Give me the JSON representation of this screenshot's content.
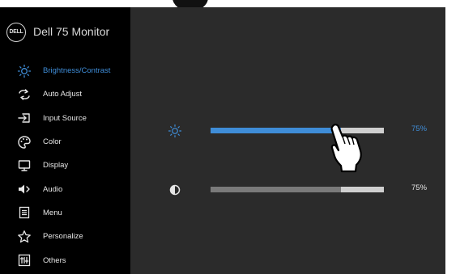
{
  "brand": {
    "title": "Dell 75 Monitor",
    "logo_text": "DELL"
  },
  "menu": [
    {
      "label": "Brightness/Contrast",
      "icon": "brightness-icon",
      "active": true
    },
    {
      "label": "Auto Adjust",
      "icon": "auto-adjust-icon",
      "active": false
    },
    {
      "label": "Input Source",
      "icon": "input-source-icon",
      "active": false
    },
    {
      "label": "Color",
      "icon": "color-palette-icon",
      "active": false
    },
    {
      "label": "Display",
      "icon": "display-icon",
      "active": false
    },
    {
      "label": "Audio",
      "icon": "speaker-icon",
      "active": false
    },
    {
      "label": "Menu",
      "icon": "menu-icon",
      "active": false
    },
    {
      "label": "Personalize",
      "icon": "star-icon",
      "active": false
    },
    {
      "label": "Others",
      "icon": "others-icon",
      "active": false
    }
  ],
  "brightness": {
    "icon": "brightness-icon",
    "value": 75,
    "value_label": "75%"
  },
  "contrast": {
    "icon": "contrast-icon",
    "value": 75,
    "value_label": "75%"
  },
  "colors": {
    "accent": "#3f8dd8",
    "panel": "#2b2b2b",
    "sidebar": "#000000",
    "track": "#cfcfcf",
    "contrast_fill": "#7a7a7a"
  }
}
